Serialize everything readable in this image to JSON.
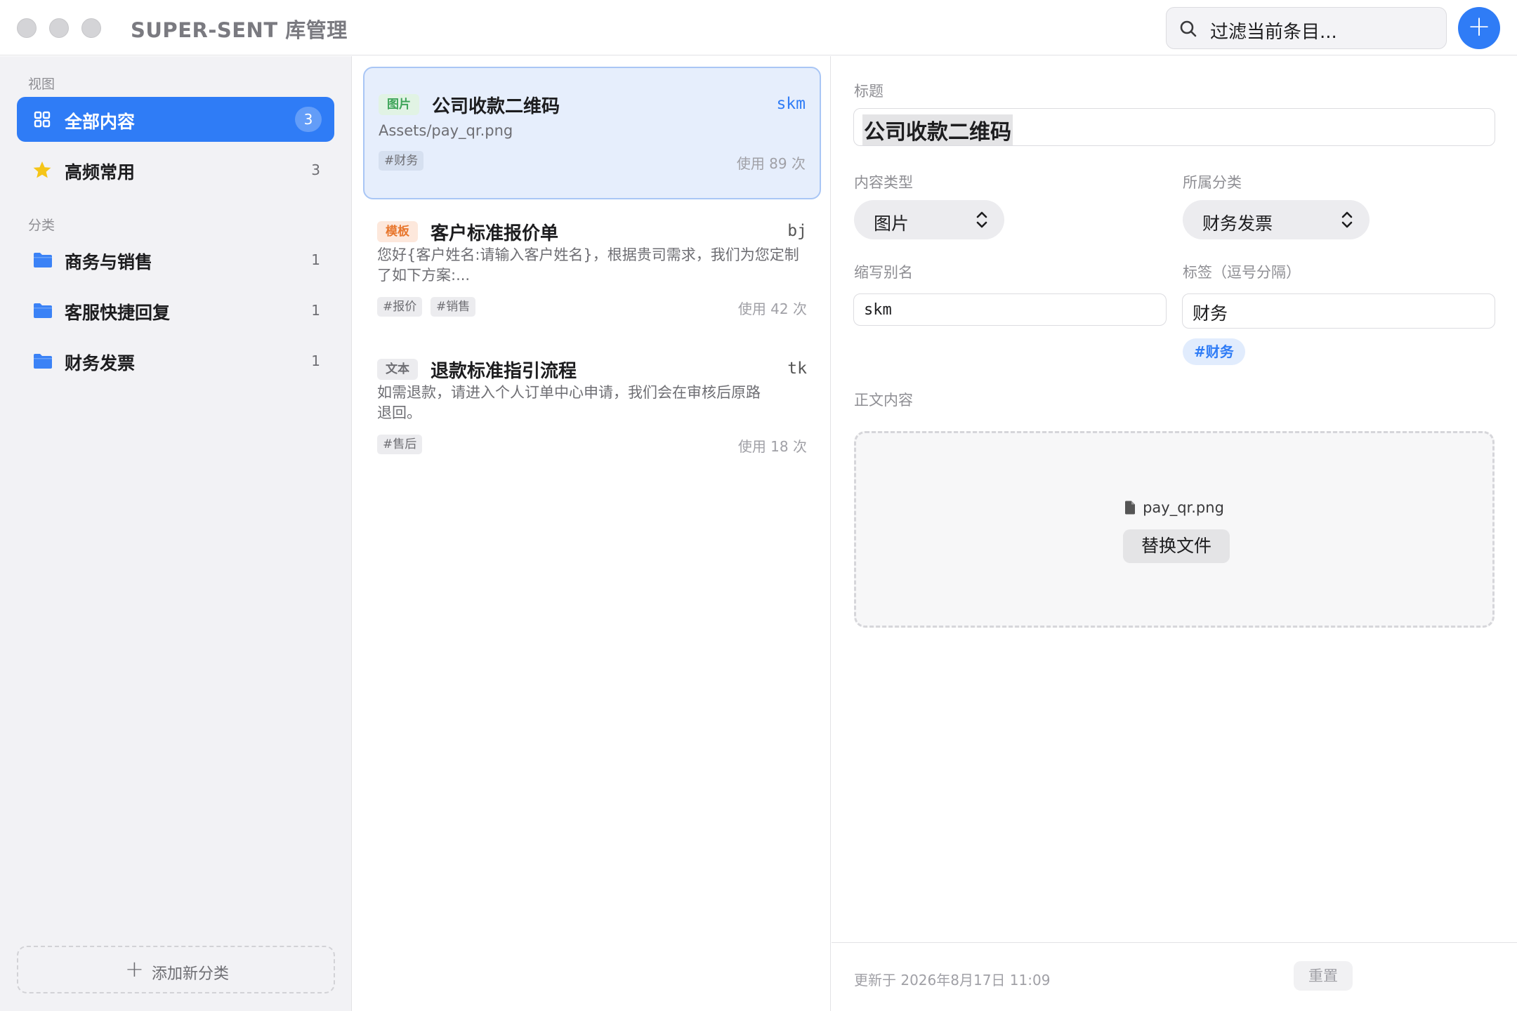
{
  "window": {
    "title": "SUPER-SENT 库管理"
  },
  "search": {
    "placeholder": "过滤当前条目..."
  },
  "toolbar": {
    "add_icon": "plus-icon",
    "add_label": "+"
  },
  "sidebar": {
    "views_label": "视图",
    "views": [
      {
        "label": "全部内容",
        "count": "3",
        "icon": "grid-icon",
        "active": true
      },
      {
        "label": "高频常用",
        "count": "3",
        "icon": "star-icon",
        "active": false
      }
    ],
    "categories_label": "分类",
    "categories": [
      {
        "label": "商务与销售",
        "count": "1",
        "icon": "folder-icon"
      },
      {
        "label": "客服快捷回复",
        "count": "1",
        "icon": "folder-icon"
      },
      {
        "label": "财务发票",
        "count": "1",
        "icon": "folder-icon"
      }
    ],
    "add_category_label": "添加新分类",
    "add_category_plus": "+"
  },
  "entries": [
    {
      "type": "图片",
      "title": "公司收款二维码",
      "abbr": "skm",
      "desc": "Assets/pay_qr.png",
      "tags": [
        "#财务"
      ],
      "usage": "使用 89 次",
      "selected": true
    },
    {
      "type": "模板",
      "title": "客户标准报价单",
      "abbr": "bj",
      "desc": "您好{客户姓名:请输入客户姓名}，根据贵司需求，我们为您定制了如下方案:...",
      "tags": [
        "#报价",
        "#销售"
      ],
      "usage": "使用 42 次",
      "selected": false
    },
    {
      "type": "文本",
      "title": "退款标准指引流程",
      "abbr": "tk",
      "desc": "如需退款，请进入个人订单中心申请，我们会在审核后原路退回。",
      "tags": [
        "#售后"
      ],
      "usage": "使用 18 次",
      "selected": false
    }
  ],
  "detail": {
    "title_label": "标题",
    "title_value": "公司收款二维码",
    "type_label": "内容类型",
    "type_value": "图片",
    "category_label": "所属分类",
    "category_value": "财务发票",
    "abbr_label": "缩写别名",
    "abbr_value": "skm",
    "tags_label": "标签（逗号分隔）",
    "tags_value": "财务",
    "tag_preview": "#财务",
    "body_label": "正文内容",
    "file_name": "pay_qr.png",
    "replace_label": "替换文件",
    "updated": "更新于 2026年8月17日 11:09",
    "reset_label": "重置"
  },
  "colors": {
    "accent": "#2f7cf6",
    "sidebar_bg": "#f2f2f5",
    "star": "#f5c518"
  }
}
